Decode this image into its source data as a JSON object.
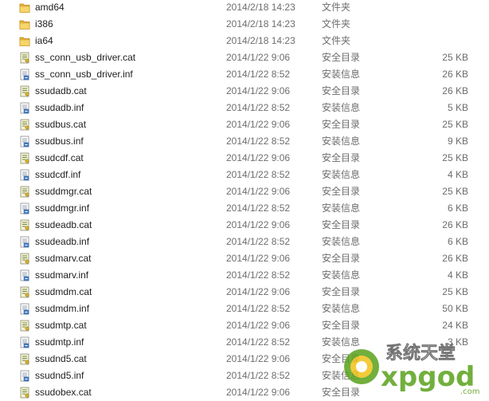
{
  "files": [
    {
      "name": "amd64",
      "date": "2014/2/18 14:23",
      "type": "文件夹",
      "size": "",
      "icon": "folder-icon"
    },
    {
      "name": "i386",
      "date": "2014/2/18 14:23",
      "type": "文件夹",
      "size": "",
      "icon": "folder-icon"
    },
    {
      "name": "ia64",
      "date": "2014/2/18 14:23",
      "type": "文件夹",
      "size": "",
      "icon": "folder-icon"
    },
    {
      "name": "ss_conn_usb_driver.cat",
      "date": "2014/1/22 9:06",
      "type": "安全目录",
      "size": "25 KB",
      "icon": "catalog-file-icon"
    },
    {
      "name": "ss_conn_usb_driver.inf",
      "date": "2014/1/22 8:52",
      "type": "安装信息",
      "size": "26 KB",
      "icon": "setup-info-file-icon"
    },
    {
      "name": "ssudadb.cat",
      "date": "2014/1/22 9:06",
      "type": "安全目录",
      "size": "26 KB",
      "icon": "catalog-file-icon"
    },
    {
      "name": "ssudadb.inf",
      "date": "2014/1/22 8:52",
      "type": "安装信息",
      "size": "5 KB",
      "icon": "setup-info-file-icon"
    },
    {
      "name": "ssudbus.cat",
      "date": "2014/1/22 9:06",
      "type": "安全目录",
      "size": "25 KB",
      "icon": "catalog-file-icon"
    },
    {
      "name": "ssudbus.inf",
      "date": "2014/1/22 8:52",
      "type": "安装信息",
      "size": "9 KB",
      "icon": "setup-info-file-icon"
    },
    {
      "name": "ssudcdf.cat",
      "date": "2014/1/22 9:06",
      "type": "安全目录",
      "size": "25 KB",
      "icon": "catalog-file-icon"
    },
    {
      "name": "ssudcdf.inf",
      "date": "2014/1/22 8:52",
      "type": "安装信息",
      "size": "4 KB",
      "icon": "setup-info-file-icon"
    },
    {
      "name": "ssuddmgr.cat",
      "date": "2014/1/22 9:06",
      "type": "安全目录",
      "size": "25 KB",
      "icon": "catalog-file-icon"
    },
    {
      "name": "ssuddmgr.inf",
      "date": "2014/1/22 8:52",
      "type": "安装信息",
      "size": "6 KB",
      "icon": "setup-info-file-icon"
    },
    {
      "name": "ssudeadb.cat",
      "date": "2014/1/22 9:06",
      "type": "安全目录",
      "size": "26 KB",
      "icon": "catalog-file-icon"
    },
    {
      "name": "ssudeadb.inf",
      "date": "2014/1/22 8:52",
      "type": "安装信息",
      "size": "6 KB",
      "icon": "setup-info-file-icon"
    },
    {
      "name": "ssudmarv.cat",
      "date": "2014/1/22 9:06",
      "type": "安全目录",
      "size": "26 KB",
      "icon": "catalog-file-icon"
    },
    {
      "name": "ssudmarv.inf",
      "date": "2014/1/22 8:52",
      "type": "安装信息",
      "size": "4 KB",
      "icon": "setup-info-file-icon"
    },
    {
      "name": "ssudmdm.cat",
      "date": "2014/1/22 9:06",
      "type": "安全目录",
      "size": "25 KB",
      "icon": "catalog-file-icon"
    },
    {
      "name": "ssudmdm.inf",
      "date": "2014/1/22 8:52",
      "type": "安装信息",
      "size": "50 KB",
      "icon": "setup-info-file-icon"
    },
    {
      "name": "ssudmtp.cat",
      "date": "2014/1/22 9:06",
      "type": "安全目录",
      "size": "24 KB",
      "icon": "catalog-file-icon"
    },
    {
      "name": "ssudmtp.inf",
      "date": "2014/1/22 8:52",
      "type": "安装信息",
      "size": "3 KB",
      "icon": "setup-info-file-icon"
    },
    {
      "name": "ssudnd5.cat",
      "date": "2014/1/22 9:06",
      "type": "安全目录",
      "size": "",
      "icon": "catalog-file-icon"
    },
    {
      "name": "ssudnd5.inf",
      "date": "2014/1/22 8:52",
      "type": "安装信息",
      "size": "",
      "icon": "setup-info-file-icon"
    },
    {
      "name": "ssudobex.cat",
      "date": "2014/1/22 9:06",
      "type": "安全目录",
      "size": "",
      "icon": "catalog-file-icon"
    }
  ],
  "watermark": {
    "title": "系统天堂",
    "brand": "xpgod",
    "domain": ".com",
    "colors": {
      "green": "#5aa21c",
      "orange": "#f28c1a",
      "title": "#ffffff"
    }
  }
}
